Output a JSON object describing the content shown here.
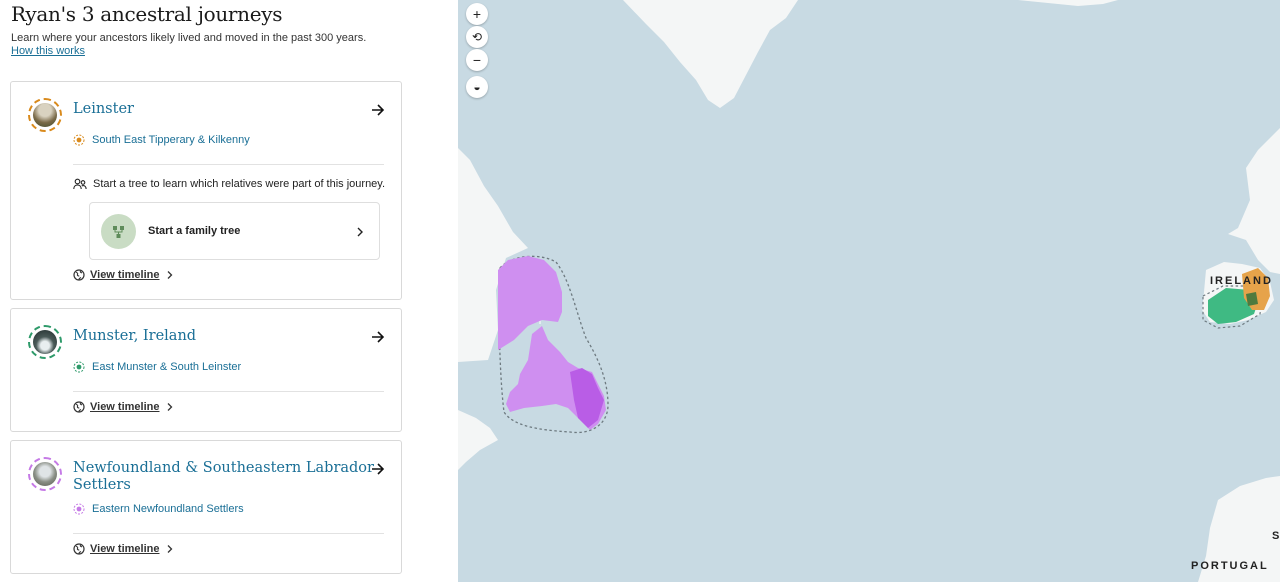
{
  "header": {
    "title": "Ryan's 3 ancestral journeys",
    "subtitle": "Learn where your ancestors likely lived and moved in the past 300 years.",
    "how_link": "How this works"
  },
  "journeys": [
    {
      "title": "Leinster",
      "region": "South East Tipperary & Kilkenny",
      "color": "#d98a1c",
      "tree_note": "Start a tree to learn which relatives were part of this journey.",
      "tree_button": "Start a family tree",
      "timeline": "View timeline"
    },
    {
      "title": "Munster, Ireland",
      "region": "East Munster & South Leinster",
      "color": "#2e9a6a",
      "timeline": "View timeline"
    },
    {
      "title_line1": "Newfoundland & Southeastern Labrador",
      "title_line2": "Settlers",
      "region": "Eastern Newfoundland Settlers",
      "color": "#c57ae6",
      "timeline": "View timeline"
    }
  ],
  "map": {
    "controls": {
      "zoom_in": "+",
      "reset": "⟲",
      "zoom_out": "−",
      "layers": "◒"
    },
    "labels": {
      "ireland": "IRELAND",
      "portugal": "PORTUGAL",
      "s": "S"
    }
  }
}
